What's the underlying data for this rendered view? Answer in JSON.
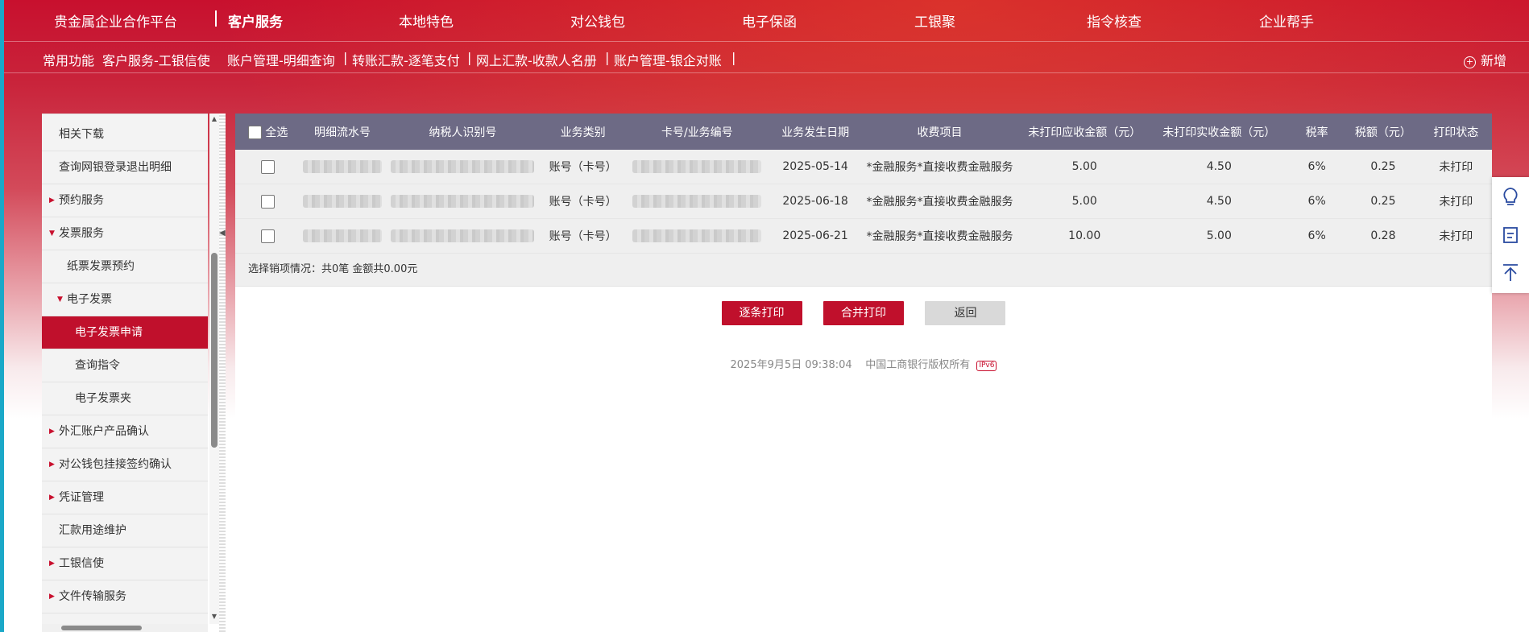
{
  "topnav": {
    "brand": "贵金属企业合作平台",
    "items": [
      "客户服务",
      "本地特色",
      "对公钱包",
      "电子保函",
      "工银聚",
      "指令核查",
      "企业帮手"
    ]
  },
  "quickbar": {
    "title": "常用功能",
    "links": [
      "客户服务-工银信使",
      "账户管理-明细查询",
      "转账汇款-逐笔支付",
      "网上汇款-收款人名册",
      "账户管理-银企对账"
    ],
    "add_label": "新增"
  },
  "sidebar": {
    "items": [
      {
        "label": "相关下载"
      },
      {
        "label": "查询网银登录退出明细"
      },
      {
        "label": "预约服务"
      },
      {
        "label": "发票服务"
      },
      {
        "label": "纸票发票预约"
      },
      {
        "label": "电子发票"
      },
      {
        "label": "电子发票申请"
      },
      {
        "label": "查询指令"
      },
      {
        "label": "电子发票夹"
      },
      {
        "label": "外汇账户产品确认"
      },
      {
        "label": "对公钱包挂接签约确认"
      },
      {
        "label": "凭证管理"
      },
      {
        "label": "汇款用途维护"
      },
      {
        "label": "工银信使"
      },
      {
        "label": "文件传输服务"
      }
    ]
  },
  "table": {
    "select_all": "全选",
    "columns": [
      "明细流水号",
      "纳税人识别号",
      "业务类别",
      "卡号/业务编号",
      "业务发生日期",
      "收费项目",
      "未打印应收金额（元）",
      "未打印实收金额（元）",
      "税率",
      "税额（元）",
      "打印状态"
    ],
    "rows": [
      {
        "category": "账号（卡号）",
        "date": "2025-05-14",
        "fee_item": "*金融服务*直接收费金融服务",
        "receivable": "5.00",
        "received": "4.50",
        "tax_rate": "6%",
        "tax": "0.25",
        "status": "未打印"
      },
      {
        "category": "账号（卡号）",
        "date": "2025-06-18",
        "fee_item": "*金融服务*直接收费金融服务",
        "receivable": "5.00",
        "received": "4.50",
        "tax_rate": "6%",
        "tax": "0.25",
        "status": "未打印"
      },
      {
        "category": "账号（卡号）",
        "date": "2025-06-21",
        "fee_item": "*金融服务*直接收费金融服务",
        "receivable": "10.00",
        "received": "5.00",
        "tax_rate": "6%",
        "tax": "0.28",
        "status": "未打印"
      }
    ],
    "summary": "选择销项情况：共0笔 金额共0.00元"
  },
  "buttons": {
    "print_each": "逐条打印",
    "print_merge": "合并打印",
    "back": "返回"
  },
  "footer": {
    "timestamp": "2025年9月5日 09:38:04",
    "copyright": "中国工商银行版权所有",
    "ipv6": "IPv6"
  },
  "colors": {
    "brand_red": "#c8102e",
    "header_gray": "#6d6a85"
  },
  "icons": {
    "float_tools": [
      "lightbulb-icon",
      "notes-icon",
      "back-to-top-icon"
    ]
  }
}
